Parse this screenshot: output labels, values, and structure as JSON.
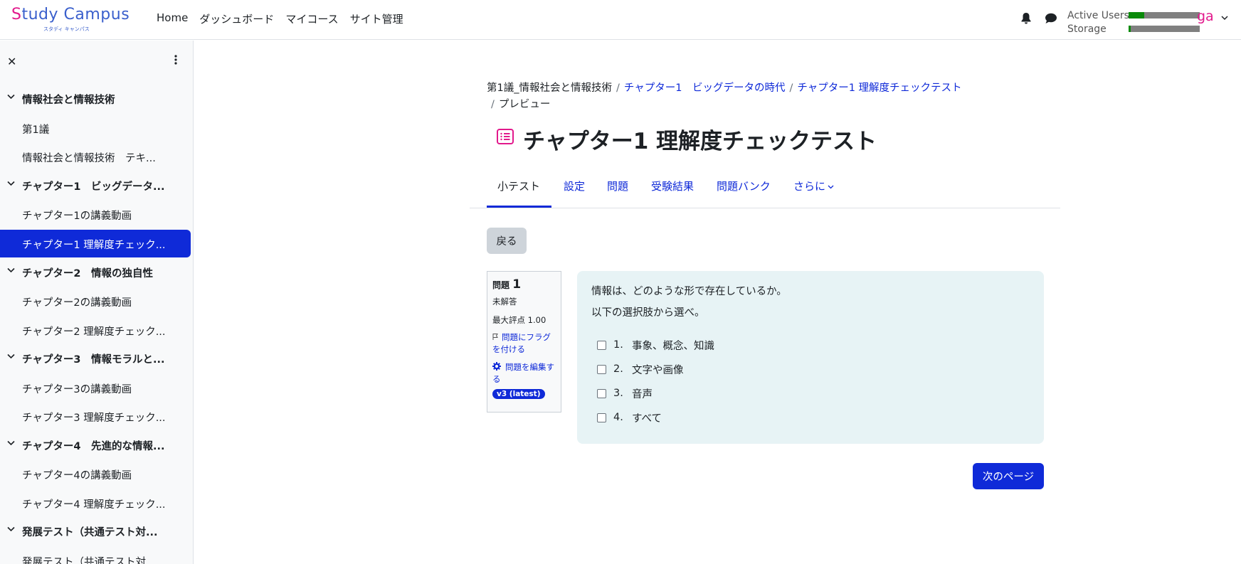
{
  "header": {
    "logo_text_s": "S",
    "logo_text_rest": "tudy Campus",
    "logo_sub": "スタディ キャンパス",
    "nav": [
      "Home",
      "ダッシュボード",
      "マイコース",
      "サイト管理"
    ],
    "usage": [
      {
        "label": "Active Users",
        "fill": 0.22
      },
      {
        "label": "Storage",
        "fill": 0.03
      }
    ],
    "avatar_initials": "ga",
    "icons": [
      "bell-icon",
      "chat-icon",
      "chevron-down-icon"
    ]
  },
  "sidebar": {
    "close_glyph": "✕",
    "items": [
      {
        "type": "section",
        "label": "情報社会と情報技術"
      },
      {
        "type": "item",
        "label": "第1議"
      },
      {
        "type": "item",
        "label": "情報社会と情報技術　テキ..."
      },
      {
        "type": "section",
        "label": "チャプター1　ビッグデータ..."
      },
      {
        "type": "item",
        "label": "チャプター1の講義動画"
      },
      {
        "type": "item",
        "label": "チャプター1 理解度チェック...",
        "active": true
      },
      {
        "type": "section",
        "label": "チャプター2　情報の独自性"
      },
      {
        "type": "item",
        "label": "チャプター2の講義動画"
      },
      {
        "type": "item",
        "label": "チャプター2 理解度チェック..."
      },
      {
        "type": "section",
        "label": "チャプター3　情報モラルと..."
      },
      {
        "type": "item",
        "label": "チャプター3の講義動画"
      },
      {
        "type": "item",
        "label": "チャプター3 理解度チェック..."
      },
      {
        "type": "section",
        "label": "チャプター4　先進的な情報..."
      },
      {
        "type": "item",
        "label": "チャプター4の講義動画"
      },
      {
        "type": "item",
        "label": "チャプター4 理解度チェック..."
      },
      {
        "type": "section",
        "label": "発展テスト（共通テスト対..."
      },
      {
        "type": "item",
        "label": "発展テスト（共通テスト対..."
      }
    ]
  },
  "breadcrumb": {
    "items": [
      {
        "label": "第1議_情報社会と情報技術",
        "link": false
      },
      {
        "label": "チャプター1　ビッグデータの時代",
        "link": true
      },
      {
        "label": "チャプター1 理解度チェックテスト",
        "link": true
      },
      {
        "label": "プレビュー",
        "link": false
      }
    ],
    "sep": "/"
  },
  "page_title": "チャプター1 理解度チェックテスト",
  "tabs": [
    {
      "label": "小テスト",
      "active": true
    },
    {
      "label": "設定"
    },
    {
      "label": "問題"
    },
    {
      "label": "受験結果"
    },
    {
      "label": "問題バンク"
    },
    {
      "label": "さらに"
    }
  ],
  "back_label": "戻る",
  "question": {
    "label": "問題",
    "number": "1",
    "status": "未解答",
    "max_mark": "最大評点 1.00",
    "flag_label": "問題にフラグを付ける",
    "edit_label": "問題を編集する",
    "version_badge": "v3 (latest)",
    "text_lines": [
      "情報は、どのような形で存在しているか。",
      "以下の選択肢から選べ。"
    ],
    "answers": [
      {
        "num": "1.",
        "text": "事象、概念、知識"
      },
      {
        "num": "2.",
        "text": "文字や画像"
      },
      {
        "num": "3.",
        "text": "音声"
      },
      {
        "num": "4.",
        "text": "すべて"
      }
    ]
  },
  "next_label": "次のページ"
}
